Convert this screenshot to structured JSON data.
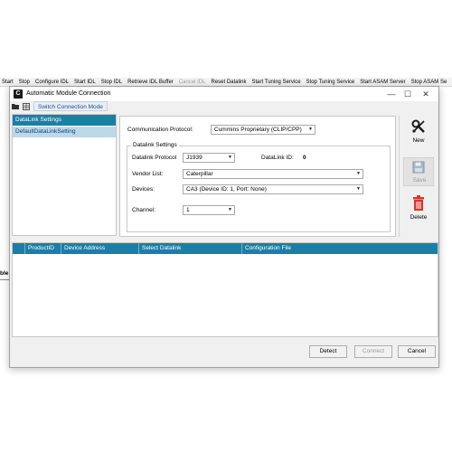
{
  "background": {
    "menu_items": [
      "Start",
      "Stop",
      "Configure IDL",
      "Start IDL",
      "Stop IDL",
      "Retrieve IDL Buffer",
      "Cancel IDL",
      "Reset Datalink",
      "Start Tuning Service",
      "Stop Tuning Service",
      "Start ASAM Server",
      "Stop ASAM Se"
    ],
    "menu_disabled": [
      false,
      false,
      false,
      false,
      false,
      false,
      true,
      false,
      false,
      false,
      false,
      false
    ],
    "left_text": "ble"
  },
  "window": {
    "title": "Automatic Module Connection",
    "minimize": "—",
    "maximize": "☐",
    "close": "✕"
  },
  "toolbar": {
    "switch_label": "Switch Connection Mode"
  },
  "left_panel": {
    "header": "DataLink Settings",
    "items": [
      "DefaultDataLinkSetting"
    ]
  },
  "settings": {
    "protocol_label": "Communication Protocol:",
    "protocol_value": "Cummins Proprietary (CLIP/CPP)",
    "group_title": "Datalink Settings",
    "datalink_protocol_label": "Datalink Protocol",
    "datalink_protocol_value": "J1939",
    "datalink_id_label": "DataLink ID:",
    "datalink_id_value": "0",
    "vendor_label": "Vendor List:",
    "vendor_value": "Caterpillar",
    "devices_label": "Devices:",
    "devices_value": "CA3 (Device ID: 1, Port: None)",
    "channel_label": "Channel:",
    "channel_value": "1"
  },
  "actions": {
    "new_label": "New",
    "save_label": "Save",
    "delete_label": "Delete"
  },
  "table": {
    "columns": [
      "ProductID",
      "Device Address",
      "Select Datalink",
      "Configuration File"
    ],
    "rows": []
  },
  "buttons": {
    "detect": "Detect",
    "connect": "Connect",
    "cancel": "Cancel"
  },
  "colors": {
    "header_blue": "#1a7fa7",
    "selected_item": "#bcd9ea",
    "delete_red": "#d9342b"
  }
}
